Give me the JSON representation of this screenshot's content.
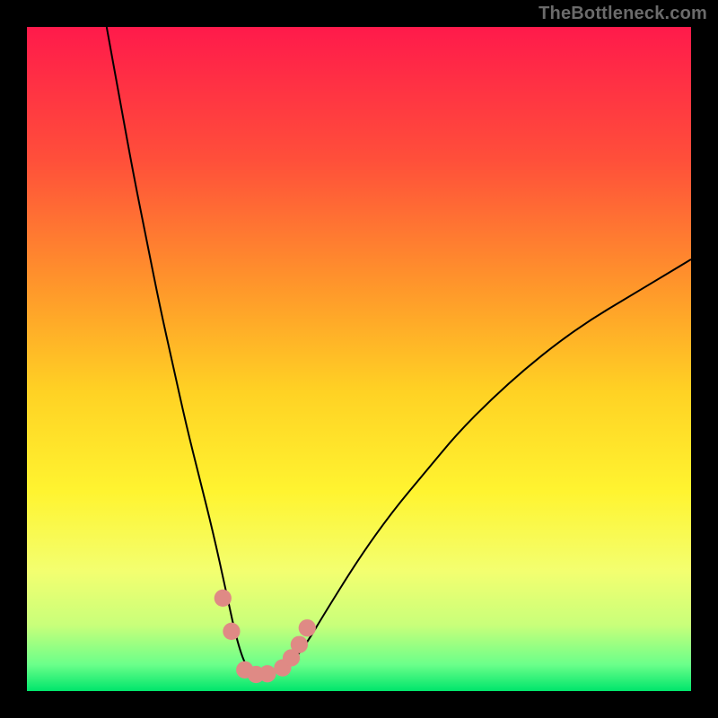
{
  "watermark": "TheBottleneck.com",
  "chart_data": {
    "type": "line",
    "title": "",
    "xlabel": "",
    "ylabel": "",
    "xlim": [
      0,
      100
    ],
    "ylim": [
      0,
      100
    ],
    "grid": false,
    "legend": false,
    "background_gradient": {
      "stops": [
        {
          "offset": 0.0,
          "color": "#ff1a4b"
        },
        {
          "offset": 0.2,
          "color": "#ff4f3a"
        },
        {
          "offset": 0.4,
          "color": "#ff9a2a"
        },
        {
          "offset": 0.55,
          "color": "#ffd224"
        },
        {
          "offset": 0.7,
          "color": "#fff430"
        },
        {
          "offset": 0.82,
          "color": "#f3ff70"
        },
        {
          "offset": 0.9,
          "color": "#c9ff7a"
        },
        {
          "offset": 0.96,
          "color": "#6bff8a"
        },
        {
          "offset": 1.0,
          "color": "#00e56b"
        }
      ]
    },
    "series": [
      {
        "name": "curve",
        "color": "#000000",
        "x": [
          12,
          14,
          16,
          18,
          20,
          22,
          24,
          26,
          28,
          30,
          31.5,
          33,
          34.5,
          36,
          38,
          40,
          42,
          45,
          50,
          55,
          60,
          65,
          70,
          75,
          80,
          85,
          90,
          95,
          100
        ],
        "y": [
          100,
          89,
          78,
          68,
          58,
          49,
          40,
          32,
          24,
          15,
          8,
          3.5,
          2.5,
          2.5,
          3,
          4.5,
          7,
          12,
          20,
          27,
          33,
          39,
          44,
          48.5,
          52.5,
          56,
          59,
          62,
          65
        ]
      }
    ],
    "highlight_points": {
      "color": "#df8a85",
      "radius_pct": 1.3,
      "points": [
        {
          "x": 29.5,
          "y": 14
        },
        {
          "x": 30.8,
          "y": 9
        },
        {
          "x": 32.8,
          "y": 3.2
        },
        {
          "x": 34.5,
          "y": 2.5
        },
        {
          "x": 36.2,
          "y": 2.6
        },
        {
          "x": 38.5,
          "y": 3.5
        },
        {
          "x": 39.8,
          "y": 5.0
        },
        {
          "x": 41.0,
          "y": 7.0
        },
        {
          "x": 42.2,
          "y": 9.5
        }
      ]
    }
  }
}
